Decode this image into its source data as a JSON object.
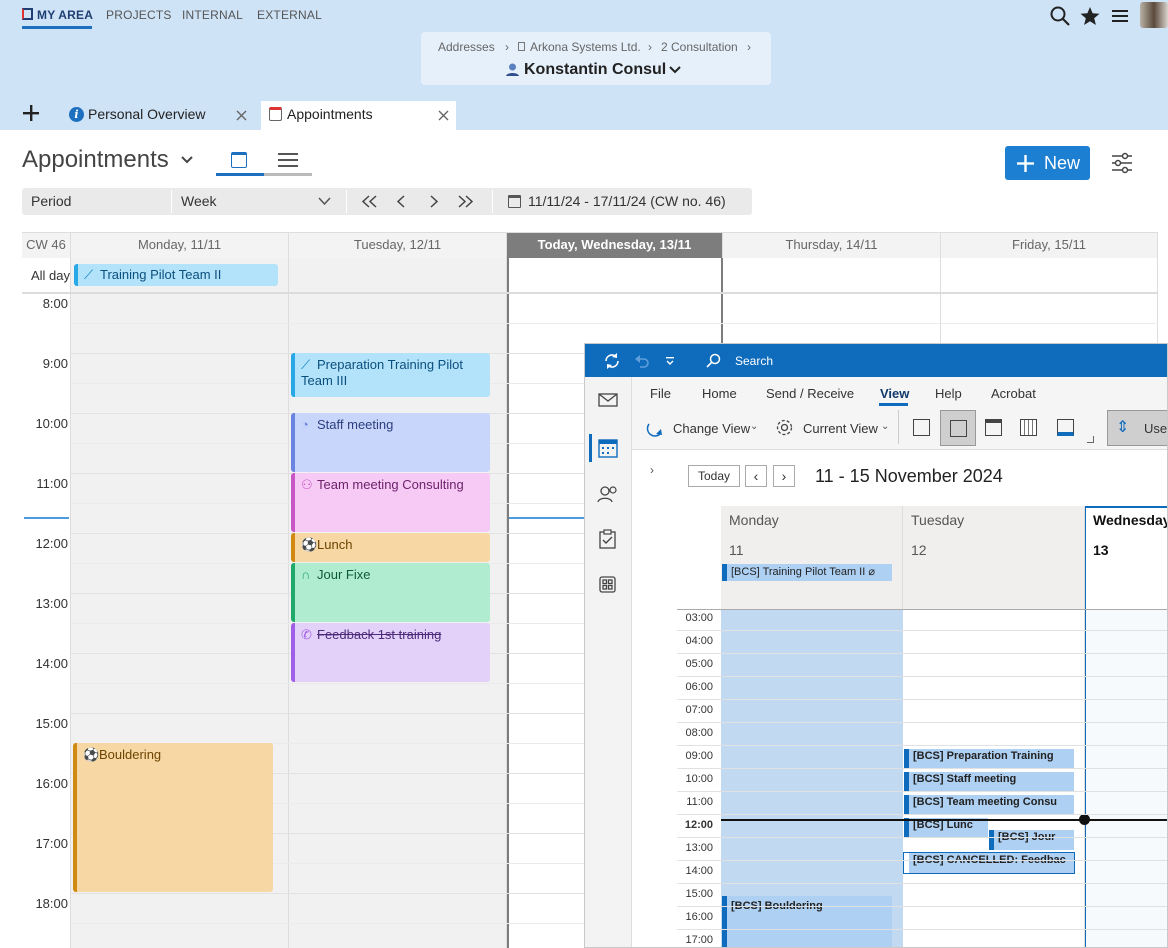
{
  "nav": {
    "my_area": "MY AREA",
    "projects": "PROJECTS",
    "internal": "INTERNAL",
    "external": "EXTERNAL"
  },
  "breadcrumb": {
    "c1": "Addresses",
    "c2": "Arkona Systems Ltd.",
    "c3": "2 Consultation",
    "sep": "›"
  },
  "owner": "Konstantin Consul",
  "tabs": {
    "personal": "Personal Overview",
    "appointments": "Appointments"
  },
  "toolbar": {
    "title": "Appointments",
    "new_label": "New",
    "period_label": "Period",
    "period_value": "Week",
    "range": "11/11/24 - 17/11/24 (CW no. 46)"
  },
  "calendar": {
    "cw": "CW 46",
    "days": [
      "Monday, 11/11",
      "Tuesday, 12/11",
      "Today, Wednesday, 13/11",
      "Thursday, 14/11",
      "Friday, 15/11"
    ],
    "all_day": "All day",
    "hours": [
      "8:00",
      "9:00",
      "10:00",
      "11:00",
      "12:00",
      "13:00",
      "14:00",
      "15:00",
      "16:00",
      "17:00",
      "18:00"
    ],
    "events": {
      "training": "Training Pilot Team II",
      "prep": "Preparation Training Pilot Team III",
      "staff": "Staff meeting",
      "team": "Team meeting Consulting",
      "lunch": "Lunch",
      "jour": "Jour Fixe",
      "feedback": "Feedback 1st training",
      "bouldering": "Bouldering"
    },
    "colors": {
      "blue": "#b3e3fb",
      "purple": "#c9d6fb",
      "pink": "#f6caf5",
      "orange": "#f7d8a4",
      "green": "#b0ecd0",
      "lavender": "#e4d1f9"
    }
  },
  "outlook": {
    "search": "Search",
    "menu": [
      "File",
      "Home",
      "Send / Receive",
      "View",
      "Help",
      "Acrobat"
    ],
    "change_view": "Change View",
    "current_view": "Current View",
    "use": "Use",
    "today": "Today",
    "range": "11 - 15 November 2024",
    "days": [
      "Monday",
      "Tuesday",
      "Wednesday"
    ],
    "dates": [
      "11",
      "12",
      "13"
    ],
    "times": [
      "03:00",
      "04:00",
      "05:00",
      "06:00",
      "07:00",
      "08:00",
      "09:00",
      "10:00",
      "11:00",
      "12:00",
      "13:00",
      "14:00",
      "15:00",
      "16:00",
      "17:00"
    ],
    "events": {
      "training": "[BCS] Training Pilot Team II",
      "prep": "[BCS] Preparation Training",
      "staff": "[BCS] Staff meeting",
      "team": "[BCS] Team meeting Consu",
      "lunch": "[BCS] Lunc",
      "jour": "[BCS] Jour",
      "cancelled": "[BCS] CANCELLED: Feedbac",
      "bouldering": "[BCS] Bouldering"
    }
  }
}
